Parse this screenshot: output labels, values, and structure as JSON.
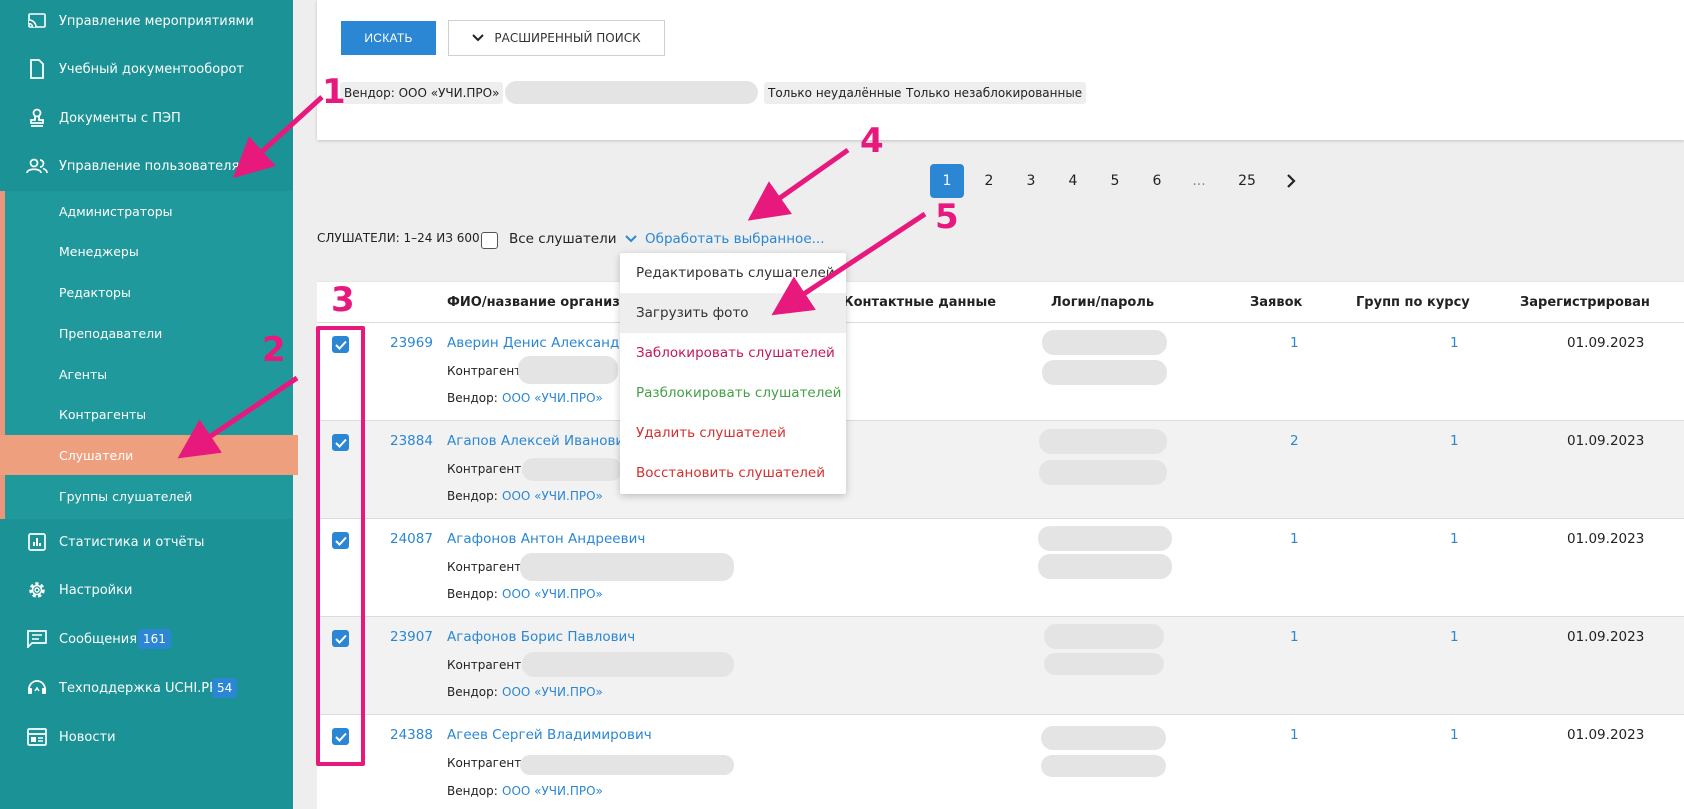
{
  "sidebar": {
    "items": [
      {
        "label": "Управление мероприятиями",
        "icon": "cast-icon"
      },
      {
        "label": "Учебный документооборот",
        "icon": "document-icon"
      },
      {
        "label": "Документы с ПЭП",
        "icon": "stamp-icon"
      },
      {
        "label": "Управление пользователями",
        "icon": "users-icon"
      }
    ],
    "submenu": [
      "Администраторы",
      "Менеджеры",
      "Редакторы",
      "Преподаватели",
      "Агенты",
      "Контрагенты",
      "Слушатели",
      "Группы слушателей"
    ],
    "bottom_items": [
      {
        "label": "Статистика и отчёты",
        "icon": "stats-icon"
      },
      {
        "label": "Настройки",
        "icon": "gear-icon"
      },
      {
        "label": "Сообщения",
        "icon": "message-icon",
        "badge": "161"
      },
      {
        "label": "Техподдержка UCHI.PRO",
        "icon": "support-icon",
        "badge": "54"
      },
      {
        "label": "Новости",
        "icon": "news-icon"
      }
    ]
  },
  "search": {
    "search_button": "ИСКАТЬ",
    "advanced_button": "РАСШИРЕННЫЙ ПОИСК",
    "chips": [
      "Вендор: ООО «УЧИ.ПРО»",
      "Только неудалённые",
      "Только незаблокированные"
    ]
  },
  "pagination": [
    "1",
    "2",
    "3",
    "4",
    "5",
    "6",
    "...",
    "25"
  ],
  "list": {
    "count": "СЛУШАТЕЛИ: 1–24 ИЗ 600",
    "all_label": "Все слушатели",
    "process_label": "Обработать выбранное..."
  },
  "dropdown": [
    {
      "label": "Редактировать слушателей",
      "color": "#333333"
    },
    {
      "label": "Загрузить фото",
      "color": "#333333"
    },
    {
      "label": "Заблокировать слушателей",
      "color": "#c2185b"
    },
    {
      "label": "Разблокировать слушателей",
      "color": "#43a047"
    },
    {
      "label": "Удалить слушателей",
      "color": "#d32f2f"
    },
    {
      "label": "Восстановить слушателей",
      "color": "#d32f2f"
    }
  ],
  "table": {
    "headers": [
      "ФИО/название организа",
      "Контактные данные",
      "Логин/пароль",
      "Заявок",
      "Групп по курсу",
      "Зарегистрирован"
    ],
    "contractor_label": "Контрагент:",
    "vendor_label": "Вендор:",
    "vendor_value": "ООО «УЧИ.ПРО»",
    "rows": [
      {
        "id": "23969",
        "name": "Аверин Денис Александр",
        "apps": "1",
        "groups": "1",
        "date": "01.09.2023"
      },
      {
        "id": "23884",
        "name": "Агапов Алексей Иванович",
        "apps": "2",
        "groups": "1",
        "date": "01.09.2023"
      },
      {
        "id": "24087",
        "name": "Агафонов Антон Андреевич",
        "apps": "1",
        "groups": "1",
        "date": "01.09.2023"
      },
      {
        "id": "23907",
        "name": "Агафонов Борис Павлович",
        "apps": "1",
        "groups": "1",
        "date": "01.09.2023"
      },
      {
        "id": "24388",
        "name": "Агеев Сергей Владимирович",
        "apps": "1",
        "groups": "1",
        "date": "01.09.2023"
      }
    ]
  },
  "annotations": [
    "1",
    "2",
    "3",
    "4",
    "5"
  ],
  "colors": {
    "sidebar": "#1a9296",
    "active": "#ee9f7e",
    "accent": "#2b87d4",
    "annotation": "#e8197d"
  }
}
